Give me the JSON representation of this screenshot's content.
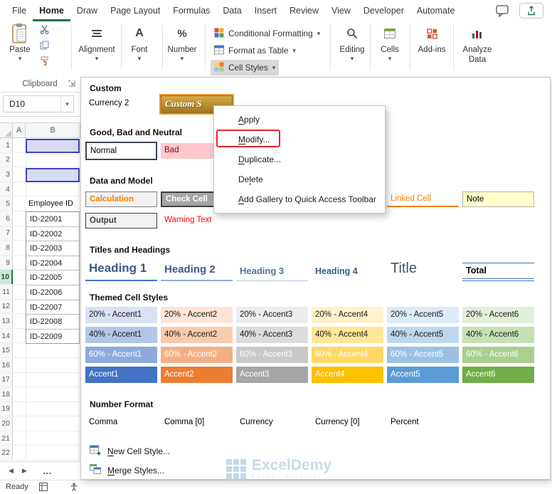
{
  "tabs": [
    {
      "label": "File",
      "active": false
    },
    {
      "label": "Home",
      "active": true
    },
    {
      "label": "Draw",
      "active": false
    },
    {
      "label": "Page Layout",
      "active": false
    },
    {
      "label": "Formulas",
      "active": false
    },
    {
      "label": "Data",
      "active": false
    },
    {
      "label": "Insert",
      "active": false
    },
    {
      "label": "Review",
      "active": false
    },
    {
      "label": "View",
      "active": false
    },
    {
      "label": "Developer",
      "active": false
    },
    {
      "label": "Automate",
      "active": false
    }
  ],
  "ribbon": {
    "paste": "Paste",
    "alignment": "Alignment",
    "font": "Font",
    "number": "Number",
    "conditional_formatting": "Conditional Formatting",
    "format_as_table": "Format as Table",
    "cell_styles": "Cell Styles",
    "editing": "Editing",
    "cells": "Cells",
    "addins": "Add-ins",
    "analyze_data": "Analyze Data",
    "clipboard": "Clipboard"
  },
  "name_box": {
    "value": "D10"
  },
  "sheet": {
    "col_headers": [
      "A",
      "B"
    ],
    "row_count": 22,
    "active_row": 10,
    "header_cell": "Employee ID",
    "ids": [
      "ID-22001",
      "ID-22002",
      "ID-22003",
      "ID-22004",
      "ID-22005",
      "ID-22006",
      "ID-22007",
      "ID-22008",
      "ID-22009"
    ]
  },
  "gallery": {
    "sections": {
      "custom": "Custom",
      "good_bad": "Good, Bad and Neutral",
      "data_model": "Data and Model",
      "titles": "Titles and Headings",
      "themed": "Themed Cell Styles",
      "number_format": "Number Format"
    },
    "custom_items": {
      "currency2": "Currency 2",
      "custom_style": "Custom S"
    },
    "good_bad_items": {
      "normal": "Normal",
      "bad": "Bad"
    },
    "data_model_items": {
      "calculation": "Calculation",
      "check_cell": "Check Cell",
      "linked_cell": "Linked Cell",
      "note": "Note",
      "output": "Output",
      "warning_text": "Warning Text"
    },
    "headings": [
      "Heading 1",
      "Heading 2",
      "Heading 3",
      "Heading 4",
      "Title",
      "Total"
    ],
    "themed_rows": [
      {
        "items": [
          {
            "label": "20% - Accent1",
            "bg": "#D9E1F2",
            "fg": "#1a1a1a"
          },
          {
            "label": "20% - Accent2",
            "bg": "#FCE4D6",
            "fg": "#1a1a1a"
          },
          {
            "label": "20% - Accent3",
            "bg": "#EDEDED",
            "fg": "#1a1a1a"
          },
          {
            "label": "20% - Accent4",
            "bg": "#FFF2CC",
            "fg": "#1a1a1a"
          },
          {
            "label": "20% - Accent5",
            "bg": "#DDEBF7",
            "fg": "#1a1a1a"
          },
          {
            "label": "20% - Accent6",
            "bg": "#E2EFDA",
            "fg": "#1a1a1a"
          }
        ]
      },
      {
        "items": [
          {
            "label": "40% - Accent1",
            "bg": "#B4C6E7",
            "fg": "#1a1a1a"
          },
          {
            "label": "40% - Accent2",
            "bg": "#F8CBAD",
            "fg": "#1a1a1a"
          },
          {
            "label": "40% - Accent3",
            "bg": "#DBDBDB",
            "fg": "#1a1a1a"
          },
          {
            "label": "40% - Accent4",
            "bg": "#FFE699",
            "fg": "#1a1a1a"
          },
          {
            "label": "40% - Accent5",
            "bg": "#BDD7EE",
            "fg": "#1a1a1a"
          },
          {
            "label": "40% - Accent6",
            "bg": "#C6E0B4",
            "fg": "#1a1a1a"
          }
        ]
      },
      {
        "items": [
          {
            "label": "60% - Accent1",
            "bg": "#8EAADB",
            "fg": "#ffffff"
          },
          {
            "label": "60% - Accent2",
            "bg": "#F4B084",
            "fg": "#ffffff"
          },
          {
            "label": "60% - Accent3",
            "bg": "#C9C9C9",
            "fg": "#ffffff"
          },
          {
            "label": "60% - Accent4",
            "bg": "#FFD966",
            "fg": "#ffffff"
          },
          {
            "label": "60% - Accent5",
            "bg": "#9BC2E6",
            "fg": "#ffffff"
          },
          {
            "label": "60% - Accent6",
            "bg": "#A9D08E",
            "fg": "#ffffff"
          }
        ]
      },
      {
        "items": [
          {
            "label": "Accent1",
            "bg": "#4472C4",
            "fg": "#ffffff"
          },
          {
            "label": "Accent2",
            "bg": "#ED7D31",
            "fg": "#ffffff"
          },
          {
            "label": "Accent3",
            "bg": "#A5A5A5",
            "fg": "#ffffff"
          },
          {
            "label": "Accent4",
            "bg": "#FFC000",
            "fg": "#ffffff"
          },
          {
            "label": "Accent5",
            "bg": "#5B9BD5",
            "fg": "#ffffff"
          },
          {
            "label": "Accent6",
            "bg": "#70AD47",
            "fg": "#ffffff"
          }
        ]
      }
    ],
    "number_format_items": [
      "Comma",
      "Comma [0]",
      "Currency",
      "Currency [0]",
      "Percent"
    ],
    "actions": [
      {
        "pre": "",
        "accel": "N",
        "post": "ew Cell Style..."
      },
      {
        "pre": "",
        "accel": "M",
        "post": "erge Styles..."
      }
    ]
  },
  "context_menu": {
    "items": [
      {
        "pre": "",
        "accel": "A",
        "post": "pply"
      },
      {
        "pre": "",
        "accel": "M",
        "post": "odify...",
        "annotated": true
      },
      {
        "pre": "",
        "accel": "D",
        "post": "uplicate..."
      },
      {
        "pre": "De",
        "accel": "l",
        "post": "ete"
      },
      {
        "pre": "",
        "accel": "A",
        "post": "dd Gallery to Quick Access Toolbar"
      }
    ]
  },
  "status": {
    "ready": "Ready"
  },
  "watermark": {
    "name": "ExcelDemy",
    "tagline": "EXCEL - DATA - BI"
  },
  "colors": {
    "excel_green": "#217346",
    "annotation_red": "#E8232A"
  }
}
